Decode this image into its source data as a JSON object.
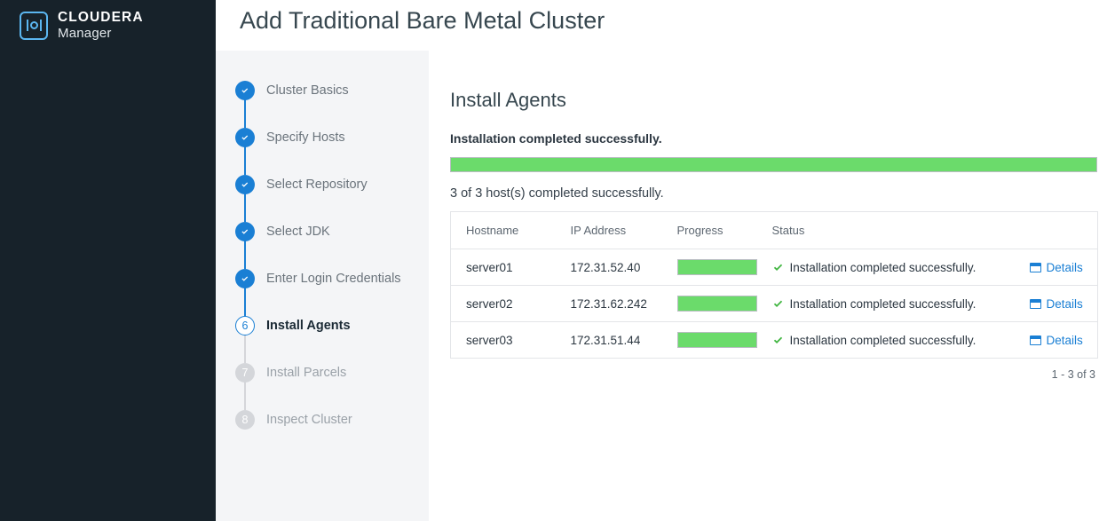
{
  "brand": {
    "name": "CLOUDERA",
    "subtitle": "Manager",
    "logo_icon": "cloudera-mark-icon",
    "accent_color": "#5bb6f0"
  },
  "header": {
    "title": "Add Traditional Bare Metal Cluster"
  },
  "wizard": {
    "steps": [
      {
        "number": "1",
        "label": "Cluster Basics",
        "state": "done"
      },
      {
        "number": "2",
        "label": "Specify Hosts",
        "state": "done"
      },
      {
        "number": "3",
        "label": "Select Repository",
        "state": "done"
      },
      {
        "number": "4",
        "label": "Select JDK",
        "state": "done"
      },
      {
        "number": "5",
        "label": "Enter Login Credentials",
        "state": "done"
      },
      {
        "number": "6",
        "label": "Install Agents",
        "state": "active"
      },
      {
        "number": "7",
        "label": "Install Parcels",
        "state": "pending"
      },
      {
        "number": "8",
        "label": "Inspect Cluster",
        "state": "pending"
      }
    ],
    "done_color": "#1a7fd4",
    "pending_color": "#d4d6da"
  },
  "main": {
    "section_title": "Install Agents",
    "status_headline": "Installation completed successfully.",
    "overall_progress_percent": 100,
    "summary": "3 of 3 host(s) completed successfully.",
    "progress_color": "#6bdb6b",
    "table": {
      "columns": [
        "Hostname",
        "IP Address",
        "Progress",
        "Status",
        ""
      ],
      "rows": [
        {
          "hostname": "server01",
          "ip": "172.31.52.40",
          "progress_percent": 100,
          "status": "Installation completed successfully.",
          "status_icon": "check-icon",
          "details_label": "Details",
          "details_icon": "window-icon"
        },
        {
          "hostname": "server02",
          "ip": "172.31.62.242",
          "progress_percent": 100,
          "status": "Installation completed successfully.",
          "status_icon": "check-icon",
          "details_label": "Details",
          "details_icon": "window-icon"
        },
        {
          "hostname": "server03",
          "ip": "172.31.51.44",
          "progress_percent": 100,
          "status": "Installation completed successfully.",
          "status_icon": "check-icon",
          "details_label": "Details",
          "details_icon": "window-icon"
        }
      ],
      "pager": "1 - 3 of 3"
    }
  }
}
